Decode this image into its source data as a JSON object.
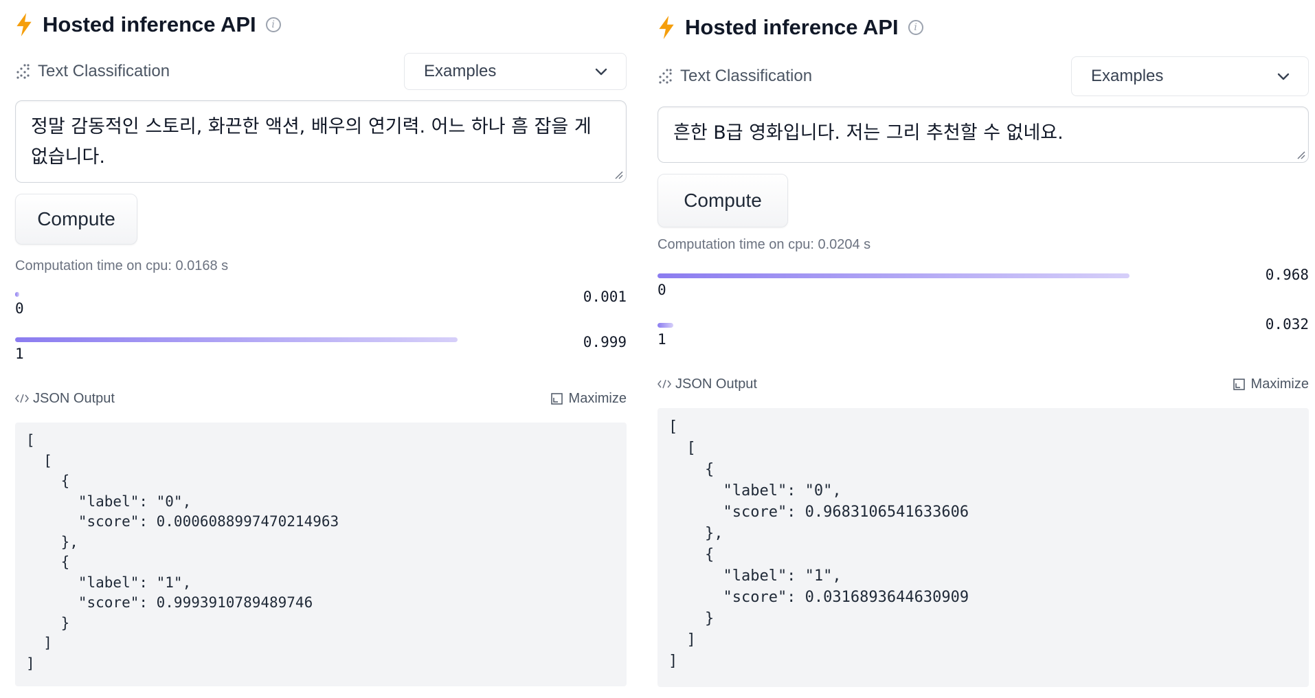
{
  "colors": {
    "bolt": "#f59e0b",
    "bar_start": "#8b7cf0",
    "bar_end": "#d6cff9",
    "code_bg": "#f3f4f6"
  },
  "icons": {
    "header": "lightning-bolt-icon",
    "info": "info-circle-icon",
    "task": "text-classification-icon",
    "dropdown": "chevron-down-icon",
    "json": "code-icon",
    "maximize": "maximize-icon"
  },
  "panels": [
    {
      "title": "Hosted inference API",
      "info_glyph": "i",
      "task": "Text Classification",
      "examples_label": "Examples",
      "input_text": "정말 감동적인 스토리, 화끈한 액션, 배우의 연기력. 어느 하나 흠 잡을 게 없습니다.",
      "compute_label": "Compute",
      "computation_time": "Computation time on cpu: 0.0168 s",
      "scores": [
        {
          "label": "0",
          "value": "0.001",
          "fraction": 0.001
        },
        {
          "label": "1",
          "value": "0.999",
          "fraction": 0.999
        }
      ],
      "json_label": "JSON Output",
      "maximize_label": "Maximize",
      "json_output": "[\n  [\n    {\n      \"label\": \"0\",\n      \"score\": 0.0006088997470214963\n    },\n    {\n      \"label\": \"1\",\n      \"score\": 0.9993910789489746\n    }\n  ]\n]"
    },
    {
      "title": "Hosted inference API",
      "info_glyph": "i",
      "task": "Text Classification",
      "examples_label": "Examples",
      "input_text": "흔한 B급 영화입니다. 저는 그리 추천할 수 없네요.",
      "compute_label": "Compute",
      "computation_time": "Computation time on cpu: 0.0204 s",
      "scores": [
        {
          "label": "0",
          "value": "0.968",
          "fraction": 0.968
        },
        {
          "label": "1",
          "value": "0.032",
          "fraction": 0.032
        }
      ],
      "json_label": "JSON Output",
      "maximize_label": "Maximize",
      "json_output": "[\n  [\n    {\n      \"label\": \"0\",\n      \"score\": 0.9683106541633606\n    },\n    {\n      \"label\": \"1\",\n      \"score\": 0.0316893644630909\n    }\n  ]\n]"
    }
  ]
}
